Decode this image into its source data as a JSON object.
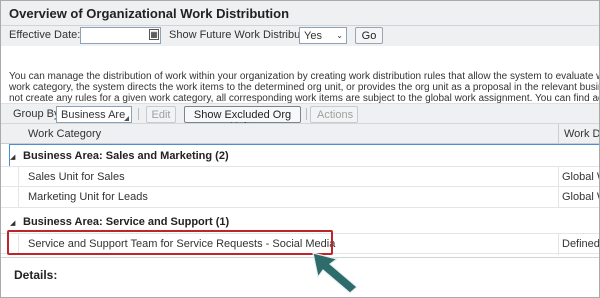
{
  "header": {
    "title": "Overview of Organizational Work Distribution"
  },
  "filters": {
    "effective_date_label": "Effective Date:",
    "effective_date_value": "",
    "show_future_label": "Show Future Work Distribution:",
    "show_future_value": "Yes",
    "go_label": "Go"
  },
  "description": {
    "lines": [
      "You can manage the distribution of work within your organization by creating work distribution rules that allow the system to evaluate work items and to",
      "work category, the system directs the work items to the determined org unit, or provides the org unit as a proposal in the relevant business document. I",
      "not create any rules for a given work category, all corresponding work items are subject to the global work assignment. You can find additional details a"
    ]
  },
  "toolbar": {
    "group_by_label": "Group By",
    "group_by_value": "Business Are",
    "edit_label": "Edit",
    "show_excluded_label": "Show Excluded Org Units",
    "actions_label": "Actions"
  },
  "table": {
    "columns": [
      "Work Category",
      "Work Dist"
    ],
    "groups": [
      {
        "label": "Business Area:  Sales and Marketing (2)",
        "rows": [
          {
            "work_category": "Sales Unit for Sales",
            "work_distribution": "Global Wo"
          },
          {
            "work_category": "Marketing Unit for Leads",
            "work_distribution": "Global Wo"
          }
        ]
      },
      {
        "label": "Business Area:  Service and Support (1)",
        "rows": [
          {
            "work_category": "Service and Support Team for Service Requests - Social Media",
            "work_distribution": "Defined W"
          }
        ]
      }
    ]
  },
  "details": {
    "label": "Details:"
  },
  "annotation": {
    "highlight_color": "#c0242b",
    "arrow_color": "#2e6b6b"
  }
}
